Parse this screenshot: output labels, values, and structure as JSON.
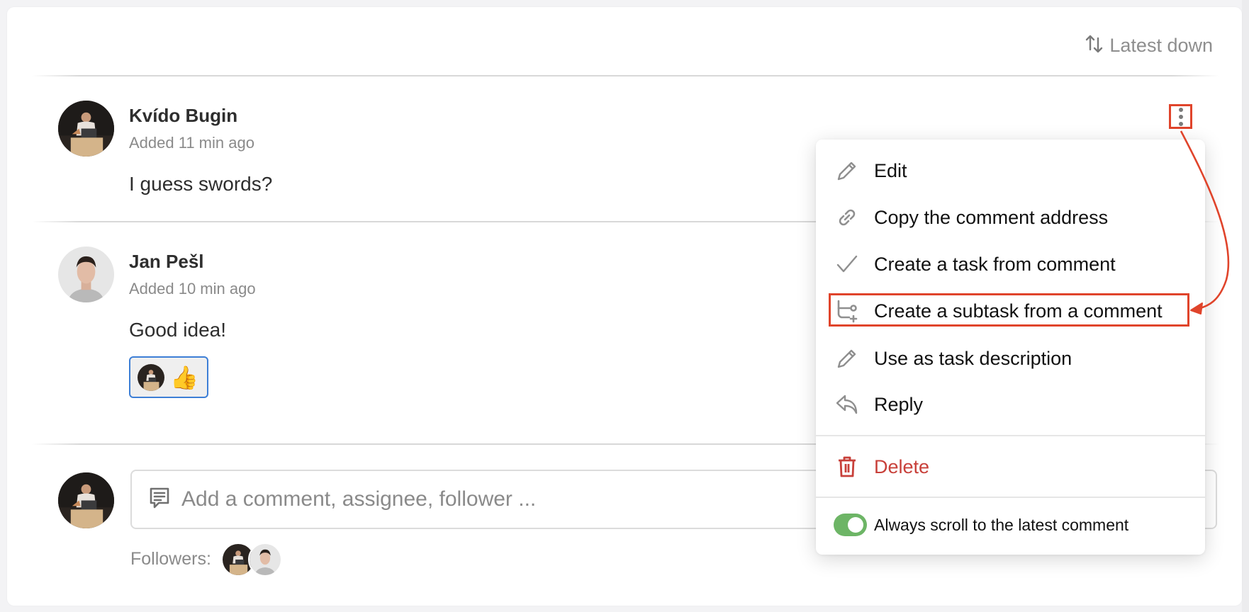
{
  "sort": {
    "label": "Latest down",
    "icon": "sort-arrows-icon"
  },
  "comments": [
    {
      "author": "Kvído Bugin",
      "meta": "Added 11 min ago",
      "text": "I guess swords?",
      "avatar": "avatar-kvido"
    },
    {
      "author": "Jan Pešl",
      "meta": "Added 10 min ago",
      "text": "Good idea!",
      "avatar": "avatar-jan",
      "reactions": [
        {
          "emoji": "👍",
          "by": "Kvído Bugin"
        }
      ]
    }
  ],
  "composer": {
    "placeholder": "Add a comment, assignee, follower ...",
    "value": "",
    "icon": "comment-icon"
  },
  "followers": {
    "label": "Followers:",
    "people": [
      "Kvído Bugin",
      "Jan Pešl"
    ]
  },
  "menu": {
    "items": [
      {
        "label": "Edit",
        "icon": "pencil-icon"
      },
      {
        "label": "Copy the comment address",
        "icon": "link-icon"
      },
      {
        "label": "Create a task from comment",
        "icon": "check-icon"
      },
      {
        "label": "Create a subtask from a comment",
        "icon": "subtask-icon",
        "highlighted": true
      },
      {
        "label": "Use as task description",
        "icon": "pencil-icon"
      },
      {
        "label": "Reply",
        "icon": "reply-icon"
      }
    ],
    "delete": {
      "label": "Delete",
      "icon": "trash-icon"
    },
    "toggle": {
      "label": "Always scroll to the latest comment",
      "on": true
    }
  },
  "colors": {
    "accent_red": "#e0442b",
    "danger": "#c8403a",
    "toggle_on": "#6db566",
    "reaction_border": "#3d7fd6"
  }
}
